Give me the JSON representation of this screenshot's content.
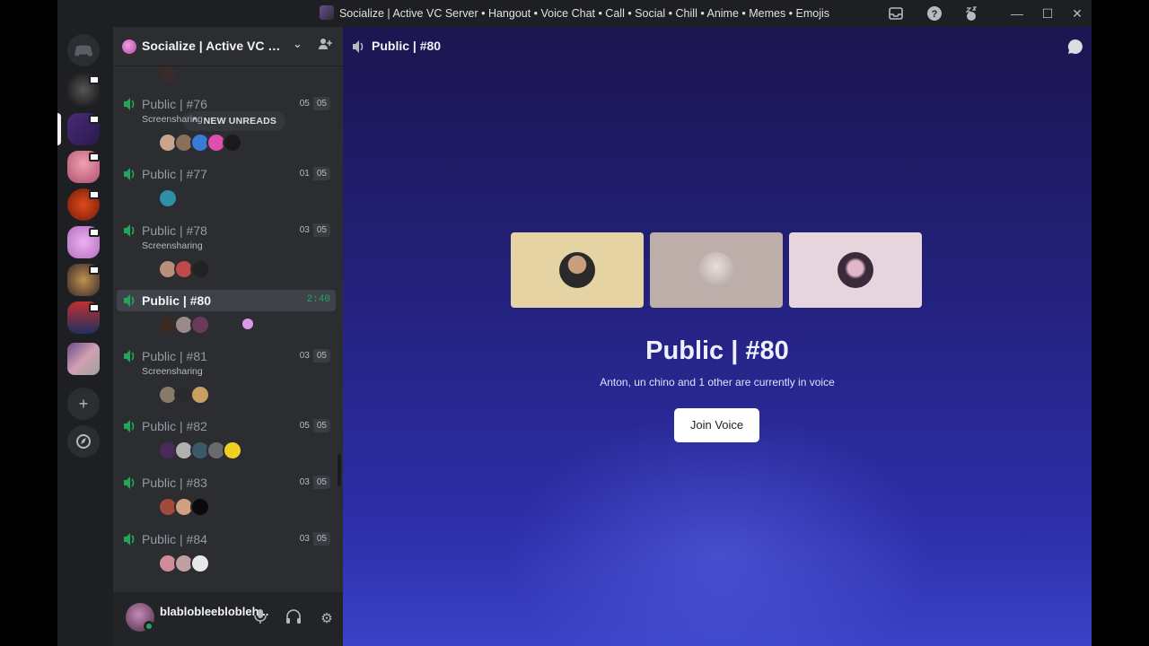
{
  "window": {
    "title": "Socialize | Active VC Server • Hangout • Voice Chat • Call • Social • Chill • Anime • Memes • Emojis",
    "controls": [
      "minimize",
      "maximize",
      "close"
    ]
  },
  "toolbar_icons": [
    "inbox-icon",
    "help-icon",
    "notification-icon"
  ],
  "server": {
    "name": "Socialize | Active VC Se...",
    "new_unreads": "NEW UNREADS"
  },
  "channels": [
    {
      "name": "Public | #76",
      "sub": "Screensharing",
      "count_a": "05",
      "count_b": "05",
      "avatars": [
        "#c9a58e",
        "#8a6f5a",
        "#3a7bd5",
        "#e04fb0",
        "#1a1a1a"
      ]
    },
    {
      "name": "Public | #77",
      "sub": "",
      "count_a": "01",
      "count_b": "05",
      "avatars": [
        "#2d8fa8"
      ]
    },
    {
      "name": "Public | #78",
      "sub": "Screensharing",
      "count_a": "03",
      "count_b": "05",
      "avatars": [
        "#b98f7a",
        "#c04a4a",
        "#222222"
      ]
    },
    {
      "name": "Public | #80",
      "sub": "",
      "timer": "2:40",
      "avatars": [
        "#3a2a22",
        "#9a8a8a",
        "#6a3a5a"
      ]
    },
    {
      "name": "Public | #81",
      "sub": "Screensharing",
      "count_a": "03",
      "count_b": "05",
      "avatars": [
        "#8a7a6a",
        "#2a2a2a",
        "#c9a060"
      ]
    },
    {
      "name": "Public | #82",
      "sub": "",
      "count_a": "05",
      "count_b": "05",
      "avatars": [
        "#4a2a5a",
        "#b0b0b0",
        "#3a5a6a",
        "#6a6a6a",
        "#f2d020"
      ]
    },
    {
      "name": "Public | #83",
      "sub": "",
      "count_a": "03",
      "count_b": "05",
      "avatars": [
        "#a04a3a",
        "#d0a080",
        "#0a0a0a"
      ]
    },
    {
      "name": "Public | #84",
      "sub": "",
      "count_a": "03",
      "count_b": "05",
      "avatars": [
        "#d08a9a",
        "#c0a0a0",
        "#e8e8e8"
      ]
    }
  ],
  "user": {
    "name": "blablobleeblobleh..."
  },
  "main": {
    "channel_header": "Public | #80",
    "vc_title": "Public | #80",
    "vc_subtitle": "Anton, un chino and 1 other are currently in voice",
    "join_label": "Join Voice",
    "tiles": [
      {
        "bg": "#e5d3a3",
        "avatar": "#2a2a2a"
      },
      {
        "bg": "#bdaea9",
        "avatar": "#d8d0cc"
      },
      {
        "bg": "#e7d5dd",
        "avatar": "#5a3a4a"
      }
    ]
  },
  "colors": {
    "accent_green": "#23a55a",
    "brand_bg": "#1e1f22",
    "sidebar_bg": "#2b2d31"
  }
}
